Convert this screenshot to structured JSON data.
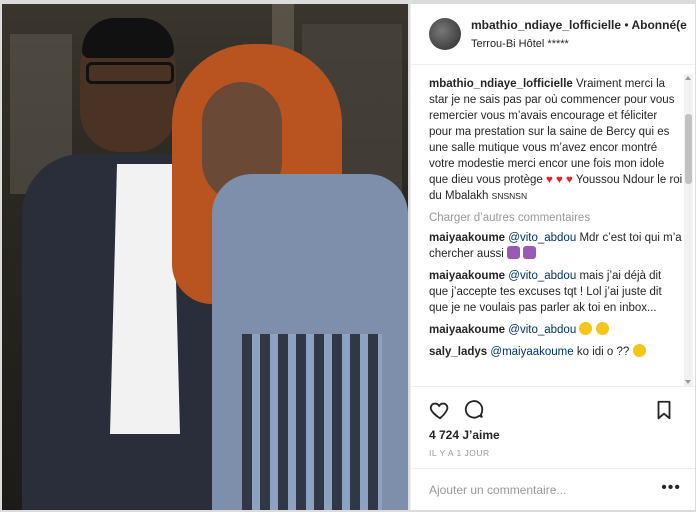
{
  "header": {
    "username": "mbathio_ndiaye_lofficielle",
    "separator": "•",
    "follow_label": "Abonné(e",
    "location": "Terrou-Bi Hôtel *****"
  },
  "caption": {
    "username": "mbathio_ndiaye_lofficielle",
    "text_before_hearts": "Vraiment merci la star je ne sais pas par où commencer pour vous remercier vous m’avais encourage et féliciter pour ma prestation sur la saine de Bercy qui es une salle mutique vous m’avez encor montré votre modestie merci encor une fois mon idole que dieu vous protège",
    "hearts": "♥ ♥ ♥",
    "text_after_hearts": "Youssou Ndour le roi du Mbalakh",
    "suffix": "SNSNSN"
  },
  "load_more_label": "Charger d’autres commentaires",
  "comments": [
    {
      "username": "maiyaakoume",
      "mention": "@vito_abdou",
      "text": "Mdr c’est toi qui m’a chercher aussi"
    },
    {
      "username": "maiyaakoume",
      "mention": "@vito_abdou",
      "text": "mais j’ai déjà dit que j’accepte tes excuses tqt ! Lol j’ai juste dit que je ne voulais pas parler ak toi en inbox..."
    },
    {
      "username": "maiyaakoume",
      "mention": "@vito_abdou",
      "text": ""
    },
    {
      "username": "saly_ladys",
      "mention": "@maiyaakoume",
      "text": "ko idi o ??"
    }
  ],
  "likes": "4 724 J’aime",
  "time_ago": "IL Y A 1 JOUR",
  "add_comment_placeholder": "Ajouter un commentaire...",
  "more_options": "•••",
  "icons": [
    "heart-icon",
    "comment-icon",
    "bookmark-icon"
  ]
}
